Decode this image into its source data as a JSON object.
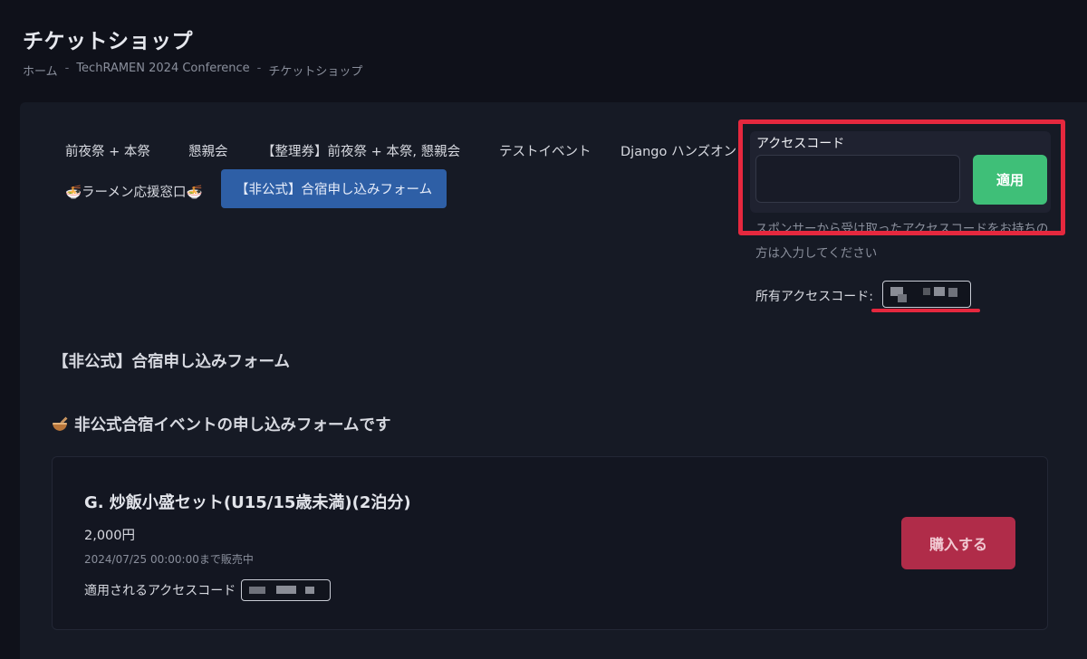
{
  "header": {
    "title": "チケットショップ",
    "breadcrumb": [
      "ホーム",
      "TechRAMEN 2024 Conference",
      "チケットショップ"
    ],
    "breadcrumb_separator": "-"
  },
  "tabs": [
    {
      "label": "前夜祭 + 本祭",
      "active": false
    },
    {
      "label": "懇親会",
      "active": false
    },
    {
      "label": "【整理券】前夜祭 + 本祭, 懇親会",
      "active": false
    },
    {
      "label": "テストイベント",
      "active": false
    },
    {
      "label": "Django ハンズオン",
      "active": false
    },
    {
      "label": "🍜ラーメン応援窓口🍜",
      "active": false
    },
    {
      "label": "【非公式】合宿申し込みフォーム",
      "active": true
    }
  ],
  "access_code": {
    "label": "アクセスコード",
    "input_value": "",
    "apply_label": "適用",
    "help_text": "スポンサーから受け取ったアクセスコードをお持ちの方は入力してください",
    "owned_label": "所有アクセスコード:"
  },
  "section": {
    "heading": "【非公式】合宿申し込みフォーム",
    "description": "非公式合宿イベントの申し込みフォームです",
    "description_icon": "ramen-bowl-icon"
  },
  "ticket": {
    "name": "G. 炒飯小盛セット(U15/15歳未満)(2泊分)",
    "price": "2,000円",
    "sale_until": "2024/07/25 00:00:00まで販売中",
    "code_label": "適用されるアクセスコード",
    "buy_label": "購入する"
  },
  "colors": {
    "background": "#0f111a",
    "panel": "#161a25",
    "active_tab": "#2e5fa6",
    "apply_button": "#3fbf78",
    "buy_button": "#b02c49",
    "highlight": "#e5283e"
  }
}
